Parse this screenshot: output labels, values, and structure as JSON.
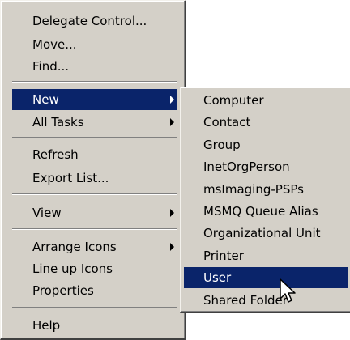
{
  "main_menu": {
    "items": [
      {
        "label": "Delegate Control..."
      },
      {
        "label": "Move..."
      },
      {
        "label": "Find..."
      },
      {
        "label": "New",
        "submenu": true
      },
      {
        "label": "All Tasks",
        "submenu": true
      },
      {
        "label": "Refresh"
      },
      {
        "label": "Export List..."
      },
      {
        "label": "View",
        "submenu": true
      },
      {
        "label": "Arrange Icons",
        "submenu": true
      },
      {
        "label": "Line up Icons"
      },
      {
        "label": "Properties"
      },
      {
        "label": "Help"
      }
    ],
    "selected": "New"
  },
  "new_submenu": {
    "items": [
      {
        "label": "Computer"
      },
      {
        "label": "Contact"
      },
      {
        "label": "Group"
      },
      {
        "label": "InetOrgPerson"
      },
      {
        "label": "msImaging-PSPs"
      },
      {
        "label": "MSMQ Queue Alias"
      },
      {
        "label": "Organizational Unit"
      },
      {
        "label": "Printer"
      },
      {
        "label": "User"
      },
      {
        "label": "Shared Folder"
      }
    ],
    "selected": "User"
  },
  "cursor": {
    "icon": "arrow-cursor-icon"
  },
  "colors": {
    "menu_background": "#d4d0c8",
    "selection": "#0a246a",
    "selection_text": "#ffffff"
  }
}
